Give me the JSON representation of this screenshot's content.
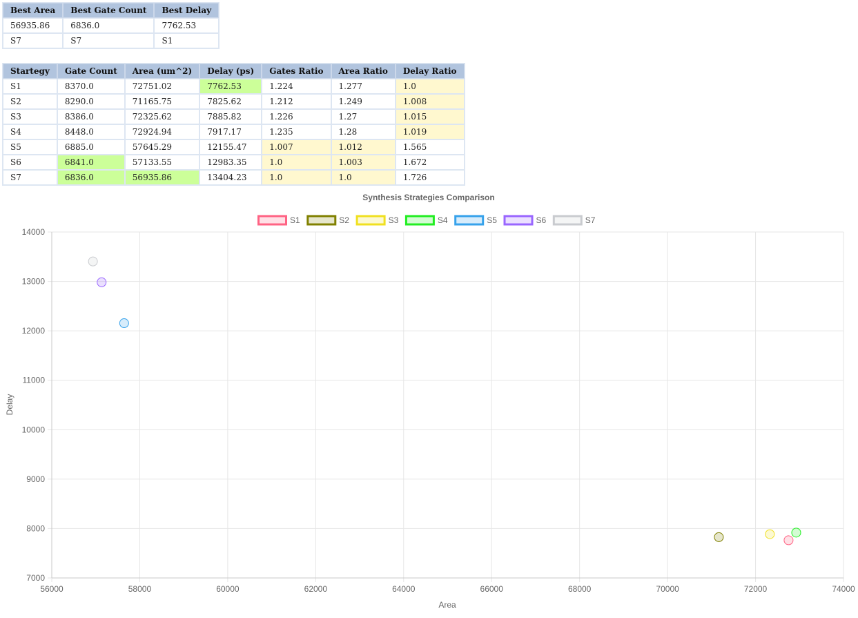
{
  "summary": {
    "headers": [
      "Best Area",
      "Best Gate Count",
      "Best Delay"
    ],
    "rows": [
      [
        "56935.86",
        "6836.0",
        "7762.53"
      ],
      [
        "S7",
        "S7",
        "S1"
      ]
    ]
  },
  "strategies": {
    "headers": [
      "Startegy",
      "Gate Count",
      "Area (um^2)",
      "Delay (ps)",
      "Gates Ratio",
      "Area Ratio",
      "Delay Ratio"
    ],
    "rows": [
      {
        "cells": [
          "S1",
          "8370.0",
          "72751.02",
          "7762.53",
          "1.224",
          "1.277",
          "1.0"
        ],
        "hl": [
          "",
          "",
          "",
          "best",
          "",
          "",
          "near"
        ]
      },
      {
        "cells": [
          "S2",
          "8290.0",
          "71165.75",
          "7825.62",
          "1.212",
          "1.249",
          "1.008"
        ],
        "hl": [
          "",
          "",
          "",
          "",
          "",
          "",
          "near"
        ]
      },
      {
        "cells": [
          "S3",
          "8386.0",
          "72325.62",
          "7885.82",
          "1.226",
          "1.27",
          "1.015"
        ],
        "hl": [
          "",
          "",
          "",
          "",
          "",
          "",
          "near"
        ]
      },
      {
        "cells": [
          "S4",
          "8448.0",
          "72924.94",
          "7917.17",
          "1.235",
          "1.28",
          "1.019"
        ],
        "hl": [
          "",
          "",
          "",
          "",
          "",
          "",
          "near"
        ]
      },
      {
        "cells": [
          "S5",
          "6885.0",
          "57645.29",
          "12155.47",
          "1.007",
          "1.012",
          "1.565"
        ],
        "hl": [
          "",
          "",
          "",
          "",
          "near",
          "near",
          ""
        ]
      },
      {
        "cells": [
          "S6",
          "6841.0",
          "57133.55",
          "12983.35",
          "1.0",
          "1.003",
          "1.672"
        ],
        "hl": [
          "",
          "best",
          "",
          "",
          "near",
          "near",
          ""
        ]
      },
      {
        "cells": [
          "S7",
          "6836.0",
          "56935.86",
          "13404.23",
          "1.0",
          "1.0",
          "1.726"
        ],
        "hl": [
          "",
          "best",
          "best",
          "",
          "near",
          "near",
          ""
        ]
      }
    ],
    "colors": {
      "best": "#ccff99",
      "near": "#fff8cf"
    }
  },
  "chart_data": {
    "type": "scatter",
    "title": "Synthesis Strategies Comparison",
    "xlabel": "Area",
    "ylabel": "Delay",
    "xlim": [
      56000,
      74000
    ],
    "ylim": [
      7000,
      14000
    ],
    "xticks": [
      56000,
      58000,
      60000,
      62000,
      64000,
      66000,
      68000,
      70000,
      72000,
      74000
    ],
    "yticks": [
      7000,
      8000,
      9000,
      10000,
      11000,
      12000,
      13000,
      14000
    ],
    "grid": true,
    "legend_position": "top",
    "series": [
      {
        "name": "S1",
        "x": 72751.02,
        "y": 7762.53,
        "border": "#ff6384",
        "fill": "rgba(255,99,132,0.2)"
      },
      {
        "name": "S2",
        "x": 71165.75,
        "y": 7825.62,
        "border": "#808000",
        "fill": "rgba(128,128,0,0.2)"
      },
      {
        "name": "S3",
        "x": 72325.62,
        "y": 7885.82,
        "border": "#f0e020",
        "fill": "rgba(240,224,32,0.2)"
      },
      {
        "name": "S4",
        "x": 72924.94,
        "y": 7917.17,
        "border": "#22ee22",
        "fill": "rgba(34,238,34,0.2)"
      },
      {
        "name": "S5",
        "x": 57645.29,
        "y": 12155.47,
        "border": "#36a2eb",
        "fill": "rgba(54,162,235,0.2)"
      },
      {
        "name": "S6",
        "x": 57133.55,
        "y": 12983.35,
        "border": "#9966ff",
        "fill": "rgba(153,102,255,0.2)"
      },
      {
        "name": "S7",
        "x": 56935.86,
        "y": 13404.23,
        "border": "#c9cbcf",
        "fill": "rgba(201,203,207,0.2)"
      }
    ]
  }
}
